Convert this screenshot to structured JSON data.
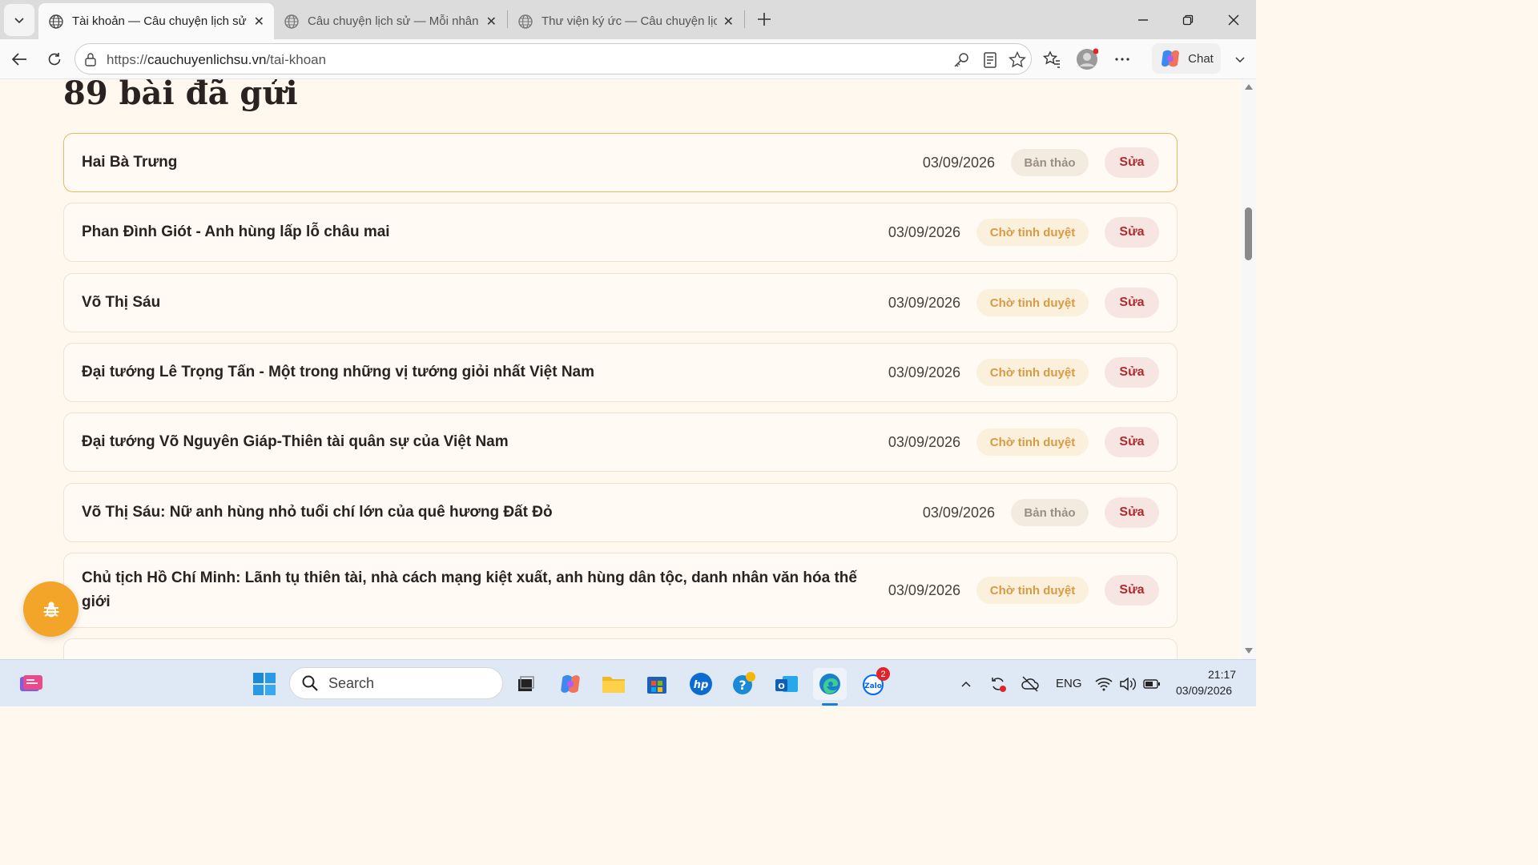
{
  "browser": {
    "tabs": [
      {
        "title": "Tài khoản — Câu chuyện lịch sử",
        "active": true
      },
      {
        "title": "Câu chuyện lịch sử — Mỗi nhân chứng",
        "active": false
      },
      {
        "title": "Thư viện ký ức — Câu chuyện lịch sử",
        "active": false
      }
    ],
    "url_scheme": "https://",
    "url_host": "cauchuyenlichsu.vn",
    "url_path": "/tai-khoan",
    "chat_label": "Chat"
  },
  "page": {
    "heading": "89 bài đã gửi",
    "posts": [
      {
        "title": "Hai Bà Trưng",
        "date": "03/09/2026",
        "status": "Bản thảo",
        "status_type": "draft",
        "edit_label": "Sửa"
      },
      {
        "title": "Phan Đình Giót - Anh hùng lấp lỗ châu mai",
        "date": "03/09/2026",
        "status": "Chờ tinh duyệt",
        "status_type": "pending",
        "edit_label": "Sửa"
      },
      {
        "title": "Võ Thị Sáu",
        "date": "03/09/2026",
        "status": "Chờ tinh duyệt",
        "status_type": "pending",
        "edit_label": "Sửa"
      },
      {
        "title": "Đại tướng Lê Trọng Tấn - Một trong những vị tướng giỏi nhất Việt Nam",
        "date": "03/09/2026",
        "status": "Chờ tinh duyệt",
        "status_type": "pending",
        "edit_label": "Sửa"
      },
      {
        "title": "Đại tướng Võ Nguyên Giáp-Thiên tài quân sự của Việt Nam",
        "date": "03/09/2026",
        "status": "Chờ tinh duyệt",
        "status_type": "pending",
        "edit_label": "Sửa"
      },
      {
        "title": "Võ Thị Sáu: Nữ anh hùng nhỏ tuổi chí lớn của quê hương Đất Đỏ",
        "date": "03/09/2026",
        "status": "Bản thảo",
        "status_type": "draft",
        "edit_label": "Sửa"
      },
      {
        "title": "Chủ tịch Hồ Chí Minh: Lãnh tụ thiên tài, nhà cách mạng kiệt xuất, anh hùng dân tộc, danh nhân văn hóa thế giới",
        "date": "03/09/2026",
        "status": "Chờ tinh duyệt",
        "status_type": "pending",
        "edit_label": "Sửa"
      }
    ]
  },
  "taskbar": {
    "search_placeholder": "Search",
    "zalo_badge": "2",
    "language": "ENG",
    "time": "21:17",
    "date": "03/09/2026"
  },
  "colors": {
    "accent_orange": "#f3a52a",
    "edit_red": "#b02a2e",
    "pending_text": "#d89a45",
    "page_bg": "#fff8ee"
  }
}
